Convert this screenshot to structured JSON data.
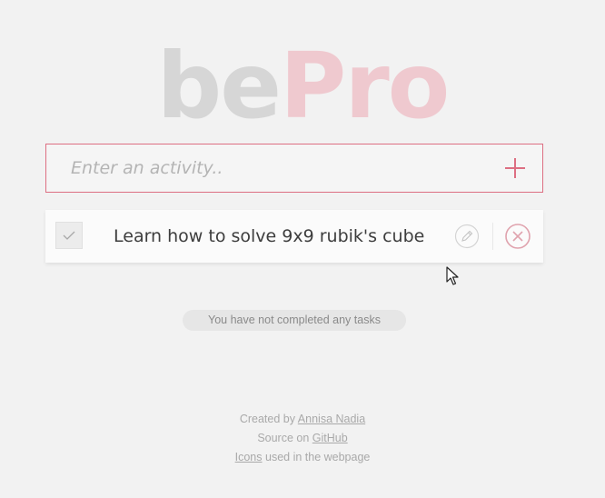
{
  "logo": {
    "part1": "be",
    "part2": "Pro"
  },
  "add_activity": {
    "placeholder": "Enter an activity..",
    "value": ""
  },
  "tasks": [
    {
      "text": "Learn how to solve 9x9 rubik's cube",
      "completed": false
    }
  ],
  "status": {
    "text": "You have not completed any tasks"
  },
  "footer": {
    "created_by": "Created by",
    "author": "Annisa Nadia",
    "source_on": "Source on",
    "github": "GitHub",
    "icons": "Icons",
    "icons_suffix": "used in the webpage"
  },
  "colors": {
    "accent": "#dd6f82",
    "logo_gray": "#d6d6d6",
    "logo_pink": "#efc9cf",
    "background": "#f2f2f2"
  },
  "icons": {
    "add": "plus-icon",
    "check": "check-icon",
    "edit": "pencil-icon",
    "delete": "circle-x-icon",
    "cursor": "mouse-pointer-icon"
  }
}
